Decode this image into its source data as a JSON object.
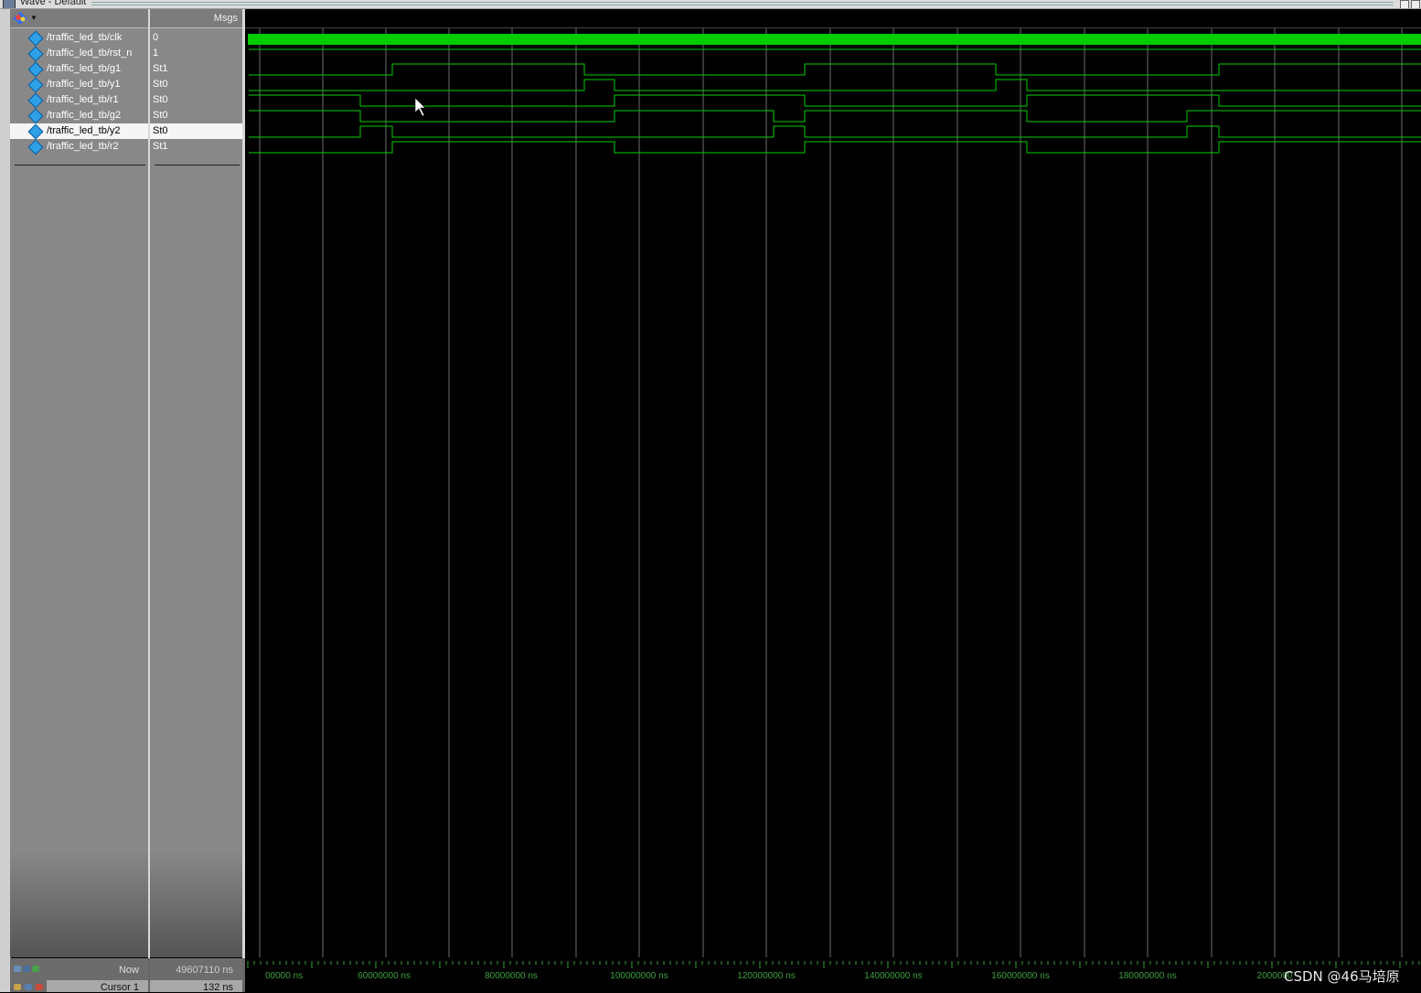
{
  "window": {
    "title": "Wave - Default"
  },
  "header": {
    "msgs_label": "Msgs"
  },
  "signals": [
    {
      "name": "/traffic_led_tb/clk",
      "value": "0"
    },
    {
      "name": "/traffic_led_tb/rst_n",
      "value": "1"
    },
    {
      "name": "/traffic_led_tb/g1",
      "value": "St1"
    },
    {
      "name": "/traffic_led_tb/y1",
      "value": "St0"
    },
    {
      "name": "/traffic_led_tb/r1",
      "value": "St0"
    },
    {
      "name": "/traffic_led_tb/g2",
      "value": "St0"
    },
    {
      "name": "/traffic_led_tb/y2",
      "value": "St0"
    },
    {
      "name": "/traffic_led_tb/r2",
      "value": "St1"
    }
  ],
  "selected_signal": "/traffic_led_tb/y2",
  "status": {
    "now_label": "Now",
    "now_value": "49607110 ns",
    "cursor_label": "Cursor 1",
    "cursor_value": "132 ns"
  },
  "time_axis": {
    "unit": "ns",
    "labels": [
      "00000 ns",
      "60000000 ns",
      "80000000 ns",
      "100000000 ns",
      "120000000 ns",
      "140000000 ns",
      "160000000 ns",
      "180000000 ns",
      "2000000"
    ]
  },
  "waveforms": {
    "clk": "dense-clock",
    "rst_n": "high",
    "g1_transitions": [
      [
        0,
        "low"
      ],
      [
        157,
        "high"
      ],
      [
        367,
        "low"
      ],
      [
        608,
        "high"
      ],
      [
        817,
        "low"
      ],
      [
        1061,
        "high"
      ]
    ],
    "y1_transitions": [
      [
        0,
        "low"
      ],
      [
        367,
        "high"
      ],
      [
        400,
        "low"
      ],
      [
        817,
        "high"
      ],
      [
        851,
        "low"
      ]
    ],
    "r1_transitions": [
      [
        0,
        "high"
      ],
      [
        122,
        "low"
      ],
      [
        400,
        "high"
      ],
      [
        608,
        "low"
      ],
      [
        851,
        "high"
      ],
      [
        1061,
        "low"
      ]
    ],
    "g2_transitions": [
      [
        0,
        "high"
      ],
      [
        122,
        "low"
      ],
      [
        400,
        "high"
      ],
      [
        574,
        "low"
      ],
      [
        608,
        "high"
      ],
      [
        851,
        "low"
      ],
      [
        1026,
        "high"
      ]
    ],
    "y2_transitions": [
      [
        0,
        "low"
      ],
      [
        122,
        "high"
      ],
      [
        157,
        "low"
      ],
      [
        574,
        "high"
      ],
      [
        608,
        "low"
      ],
      [
        1026,
        "high"
      ],
      [
        1061,
        "low"
      ]
    ],
    "r2_transitions": [
      [
        0,
        "low"
      ],
      [
        157,
        "high"
      ],
      [
        400,
        "low"
      ],
      [
        608,
        "high"
      ],
      [
        851,
        "low"
      ],
      [
        1061,
        "high"
      ]
    ]
  },
  "colors": {
    "wave": "#00d000",
    "clk_band": "#00cc00",
    "grid": "#6c6c6c",
    "background": "#000000"
  },
  "watermark": "CSDN @46马培原"
}
